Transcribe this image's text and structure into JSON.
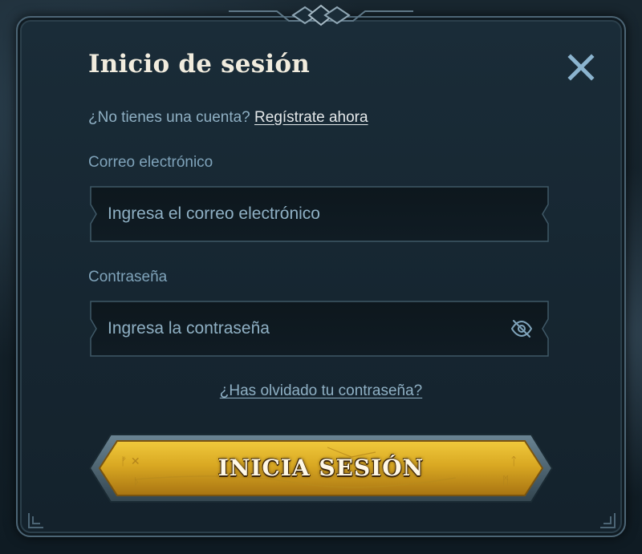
{
  "dialog": {
    "title": "Inicio de sesión",
    "close_icon": "close-icon"
  },
  "register": {
    "prompt": "¿No tienes una cuenta?",
    "link": "Regístrate ahora"
  },
  "email": {
    "label": "Correo electrónico",
    "placeholder": "Ingresa el correo electrónico",
    "value": ""
  },
  "password": {
    "label": "Contraseña",
    "placeholder": "Ingresa la contraseña",
    "value": "",
    "toggle_icon": "eye-slash-icon"
  },
  "forgot": {
    "link": "¿Has olvidado tu contraseña?"
  },
  "submit": {
    "label": "INICIA SESIÓN"
  },
  "colors": {
    "accent_blue": "#7fa3ba",
    "button_gold": "#d9a822",
    "panel": "#162631"
  }
}
